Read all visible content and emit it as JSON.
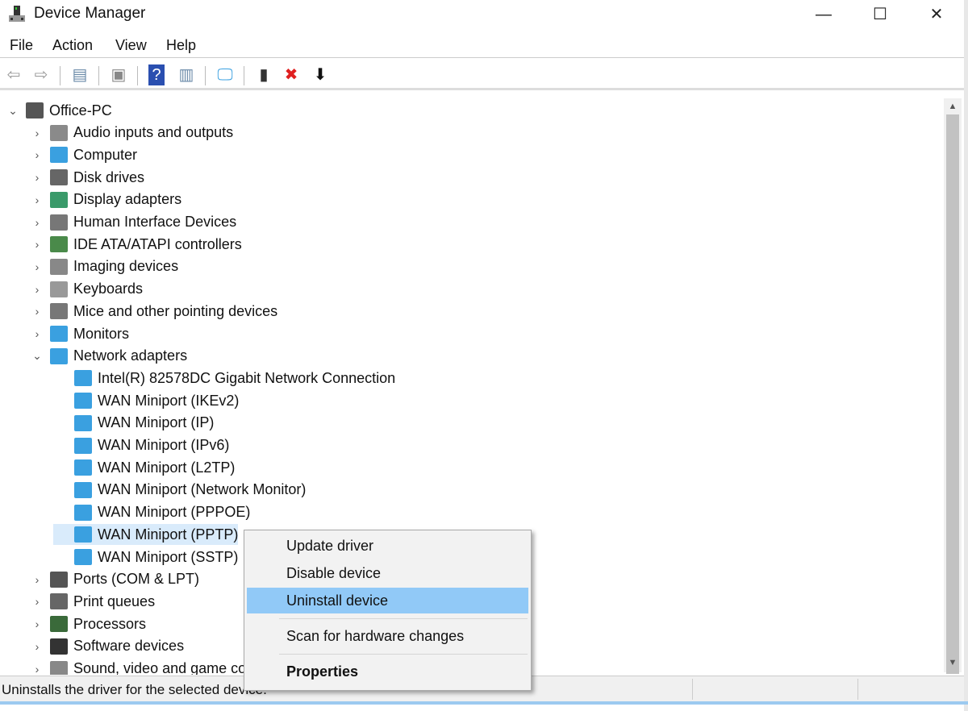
{
  "window": {
    "title": "Device Manager",
    "minimize": "—",
    "maximize": "☐",
    "close": "✕"
  },
  "menubar": [
    "File",
    "Action",
    "View",
    "Help"
  ],
  "toolbar": [
    {
      "icon": "back-icon",
      "glyph": "⇦"
    },
    {
      "icon": "forward-icon",
      "glyph": "⇨"
    },
    {
      "icon": "show-hide-console-tree-icon",
      "glyph": "▤"
    },
    {
      "icon": "properties-icon",
      "glyph": "▣"
    },
    {
      "icon": "help-icon",
      "glyph": "?"
    },
    {
      "icon": "action-pane-icon",
      "glyph": "▥"
    },
    {
      "icon": "scan-hardware-icon",
      "glyph": "🖵"
    },
    {
      "icon": "update-driver-icon",
      "glyph": "▮"
    },
    {
      "icon": "uninstall-icon",
      "glyph": "✖"
    },
    {
      "icon": "disable-device-icon",
      "glyph": "⬇"
    }
  ],
  "tree": {
    "root": "Office-PC",
    "categories": [
      {
        "label": "Audio inputs and outputs",
        "color": "#8a8a8a"
      },
      {
        "label": "Computer",
        "color": "#3aa0e0"
      },
      {
        "label": "Disk drives",
        "color": "#666"
      },
      {
        "label": "Display adapters",
        "color": "#3a9a6a"
      },
      {
        "label": "Human Interface Devices",
        "color": "#777"
      },
      {
        "label": "IDE ATA/ATAPI controllers",
        "color": "#4a8a4a"
      },
      {
        "label": "Imaging devices",
        "color": "#888"
      },
      {
        "label": "Keyboards",
        "color": "#999"
      },
      {
        "label": "Mice and other pointing devices",
        "color": "#777"
      },
      {
        "label": "Monitors",
        "color": "#3aa0e0"
      },
      {
        "label": "Network adapters",
        "color": "#3aa0e0",
        "expanded": true,
        "children": [
          "Intel(R) 82578DC Gigabit Network Connection",
          "WAN Miniport (IKEv2)",
          "WAN Miniport (IP)",
          "WAN Miniport (IPv6)",
          "WAN Miniport (L2TP)",
          "WAN Miniport (Network Monitor)",
          "WAN Miniport (PPPOE)",
          "WAN Miniport (PPTP)",
          "WAN Miniport (SSTP)"
        ]
      },
      {
        "label": "Ports (COM & LPT)",
        "color": "#555"
      },
      {
        "label": "Print queues",
        "color": "#666"
      },
      {
        "label": "Processors",
        "color": "#3a6a3a"
      },
      {
        "label": "Software devices",
        "color": "#333"
      },
      {
        "label": "Sound, video and game controllers",
        "color": "#888"
      }
    ],
    "selected": "WAN Miniport (PPTP)"
  },
  "context_menu": {
    "items": [
      "Update driver",
      "Disable device",
      "Uninstall device",
      "Scan for hardware changes",
      "Properties"
    ],
    "highlighted": "Uninstall device"
  },
  "status": "Uninstalls the driver for the selected device.",
  "colors": {
    "highlight": "#91c9f7",
    "selection": "#d9ebfb",
    "net_icon": "#3aa0e0"
  }
}
